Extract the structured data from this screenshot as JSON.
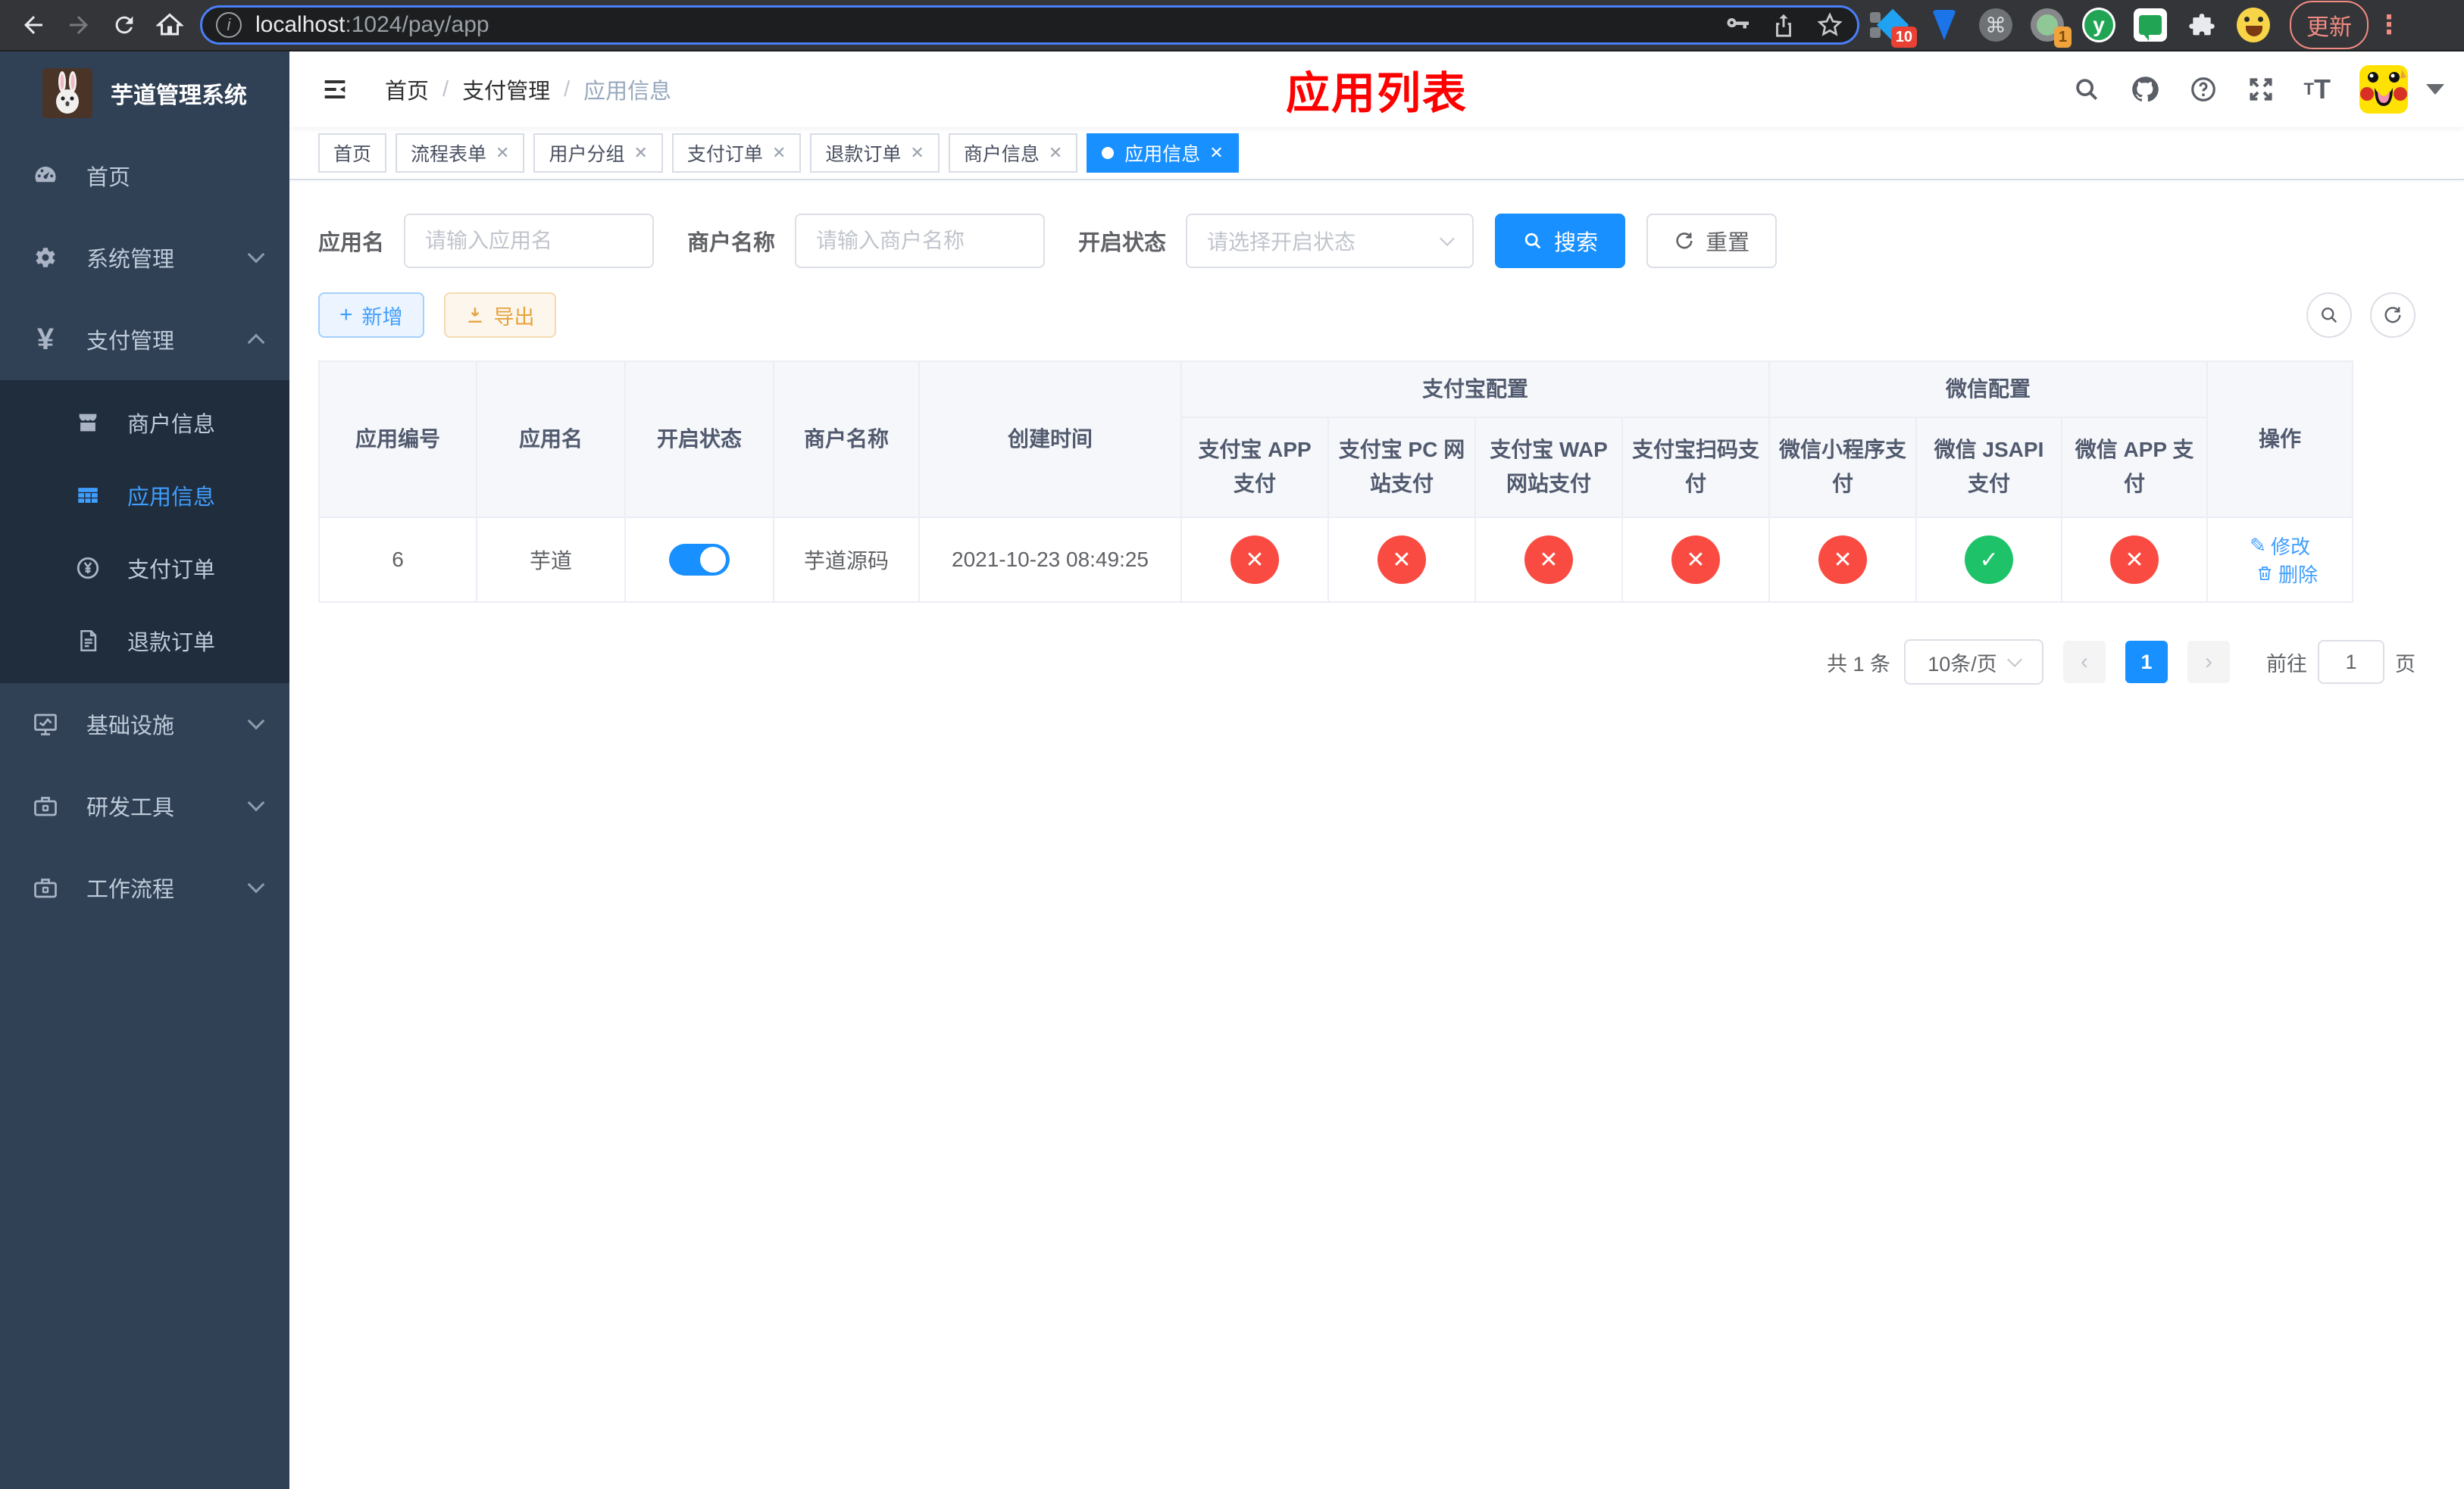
{
  "browser": {
    "url": {
      "host": "localhost",
      "path": ":1024/pay/app"
    },
    "update_label": "更新",
    "ext_badge_notifications": "10",
    "ext_badge_camera": "1"
  },
  "sidebar": {
    "title": "芋道管理系统",
    "menu": [
      {
        "label": "首页"
      },
      {
        "label": "系统管理"
      },
      {
        "label": "支付管理"
      },
      {
        "label": "基础设施"
      },
      {
        "label": "研发工具"
      },
      {
        "label": "工作流程"
      }
    ],
    "submenu": [
      {
        "label": "商户信息"
      },
      {
        "label": "应用信息"
      },
      {
        "label": "支付订单"
      },
      {
        "label": "退款订单"
      }
    ]
  },
  "navbar": {
    "breadcrumb": {
      "home": "首页",
      "section": "支付管理",
      "current": "应用信息"
    },
    "page_title": "应用列表"
  },
  "tabs": [
    {
      "label": "首页"
    },
    {
      "label": "流程表单"
    },
    {
      "label": "用户分组"
    },
    {
      "label": "支付订单"
    },
    {
      "label": "退款订单"
    },
    {
      "label": "商户信息"
    },
    {
      "label": "应用信息"
    }
  ],
  "filters": {
    "app_name_label": "应用名",
    "app_name_placeholder": "请输入应用名",
    "merchant_label": "商户名称",
    "merchant_placeholder": "请输入商户名称",
    "status_label": "开启状态",
    "status_placeholder": "请选择开启状态",
    "search_label": "搜索",
    "reset_label": "重置"
  },
  "toolbar": {
    "add_label": "新增",
    "export_label": "导出"
  },
  "table": {
    "headers": {
      "app_id": "应用编号",
      "app_name": "应用名",
      "open_status": "开启状态",
      "merchant_name": "商户名称",
      "create_time": "创建时间",
      "alipay_group": "支付宝配置",
      "wechat_group": "微信配置",
      "actions": "操作",
      "alipay_app": "支付宝 APP 支付",
      "alipay_pc": "支付宝 PC 网站支付",
      "alipay_wap": "支付宝 WAP 网站支付",
      "alipay_qr": "支付宝扫码支付",
      "wx_mini": "微信小程序支付",
      "wx_jsapi": "微信 JSAPI 支付",
      "wx_app": "微信 APP 支付"
    },
    "row": {
      "app_id": "6",
      "app_name": "芋道",
      "enabled": true,
      "merchant_name": "芋道源码",
      "create_time": "2021-10-23 08:49:25",
      "pay_status": [
        "fail",
        "fail",
        "fail",
        "fail",
        "fail",
        "success",
        "fail"
      ],
      "edit_label": "修改",
      "delete_label": "删除"
    }
  },
  "pagination": {
    "total_label": "共 1 条",
    "page_size": "10条/页",
    "current_page": "1",
    "goto_label": "前往",
    "goto_value": "1",
    "page_label": "页"
  }
}
